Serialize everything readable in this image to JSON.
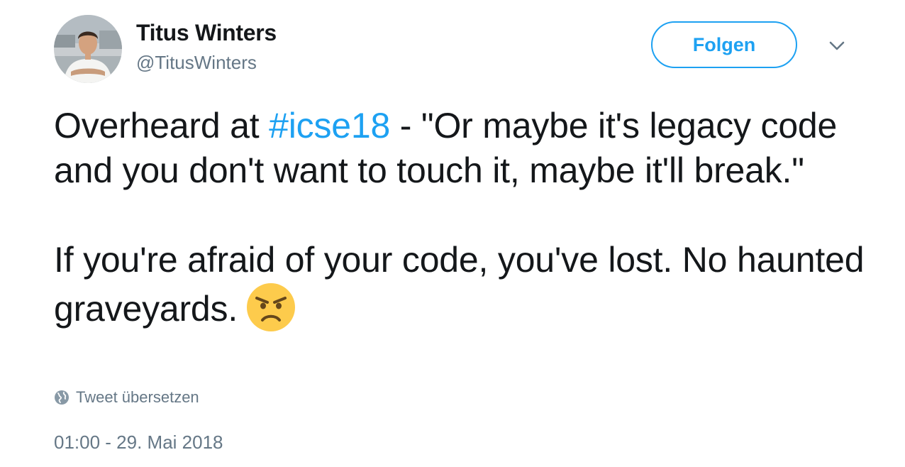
{
  "author": {
    "name": "Titus Winters",
    "handle": "@TitusWinters"
  },
  "follow_button": {
    "label": "Folgen"
  },
  "tweet": {
    "para1_before": "Overheard at ",
    "hashtag": "#icse18",
    "para1_after": " - \"Or maybe it's legacy code and you don't want to touch it, maybe it'll break.\"",
    "para2": "If you're afraid of your code, you've lost. No haunted graveyards.",
    "emoji": "angry-face"
  },
  "translate": {
    "label": "Tweet übersetzen"
  },
  "timestamp": "01:00 - 29. Mai 2018",
  "colors": {
    "accent": "#1da1f2",
    "text": "#14171a",
    "muted": "#657786"
  }
}
